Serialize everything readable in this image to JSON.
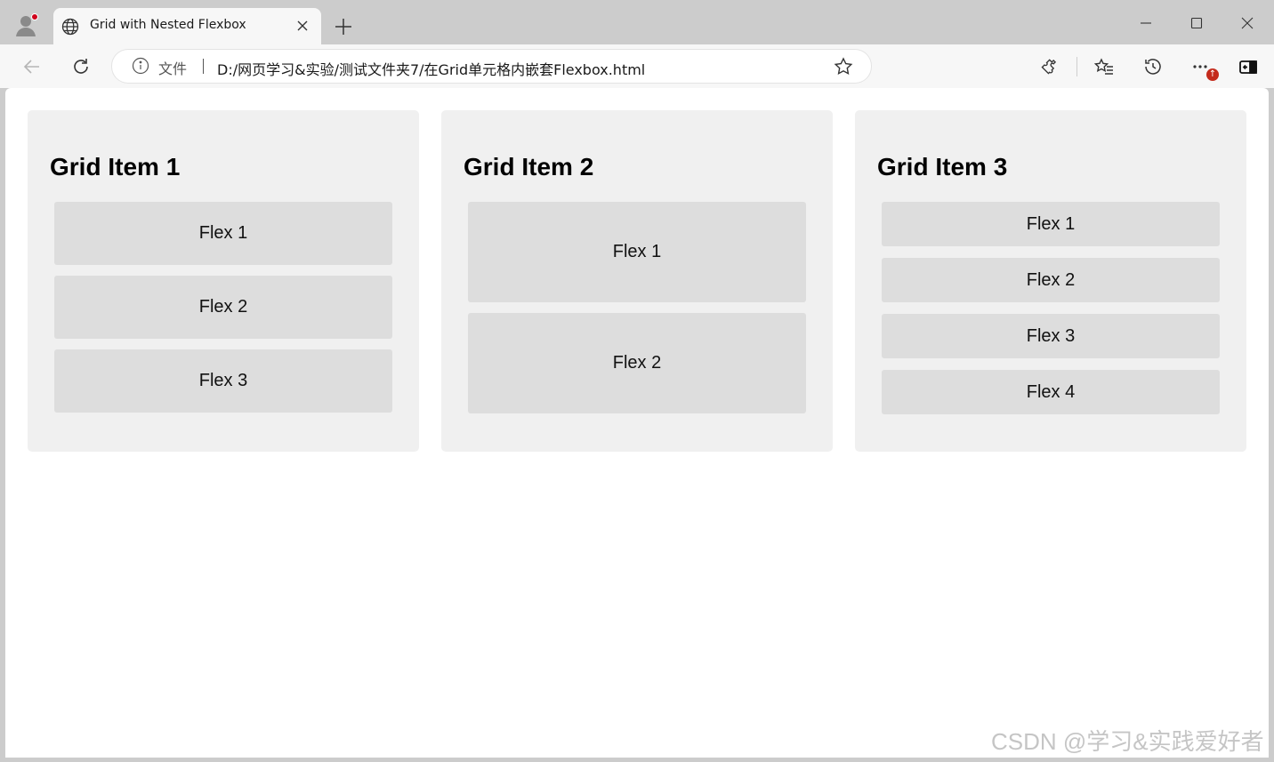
{
  "browser": {
    "tab_title": "Grid with Nested Flexbox",
    "omnibox": {
      "file_label": "文件",
      "url": "D:/网页学习&实验/测试文件夹7/在Grid单元格内嵌套Flexbox.html"
    },
    "notification_badge": "↑"
  },
  "page": {
    "grid_items": [
      {
        "title": "Grid Item 1",
        "flex_items": [
          "Flex 1",
          "Flex 2",
          "Flex 3"
        ]
      },
      {
        "title": "Grid Item 2",
        "flex_items": [
          "Flex 1",
          "Flex 2"
        ]
      },
      {
        "title": "Grid Item 3",
        "flex_items": [
          "Flex 1",
          "Flex 2",
          "Flex 3",
          "Flex 4"
        ]
      }
    ]
  },
  "watermark": "CSDN @学习&实践爱好者",
  "colors": {
    "grid_item_bg": "#f0f0f0",
    "flex_item_bg": "#dddddd"
  }
}
